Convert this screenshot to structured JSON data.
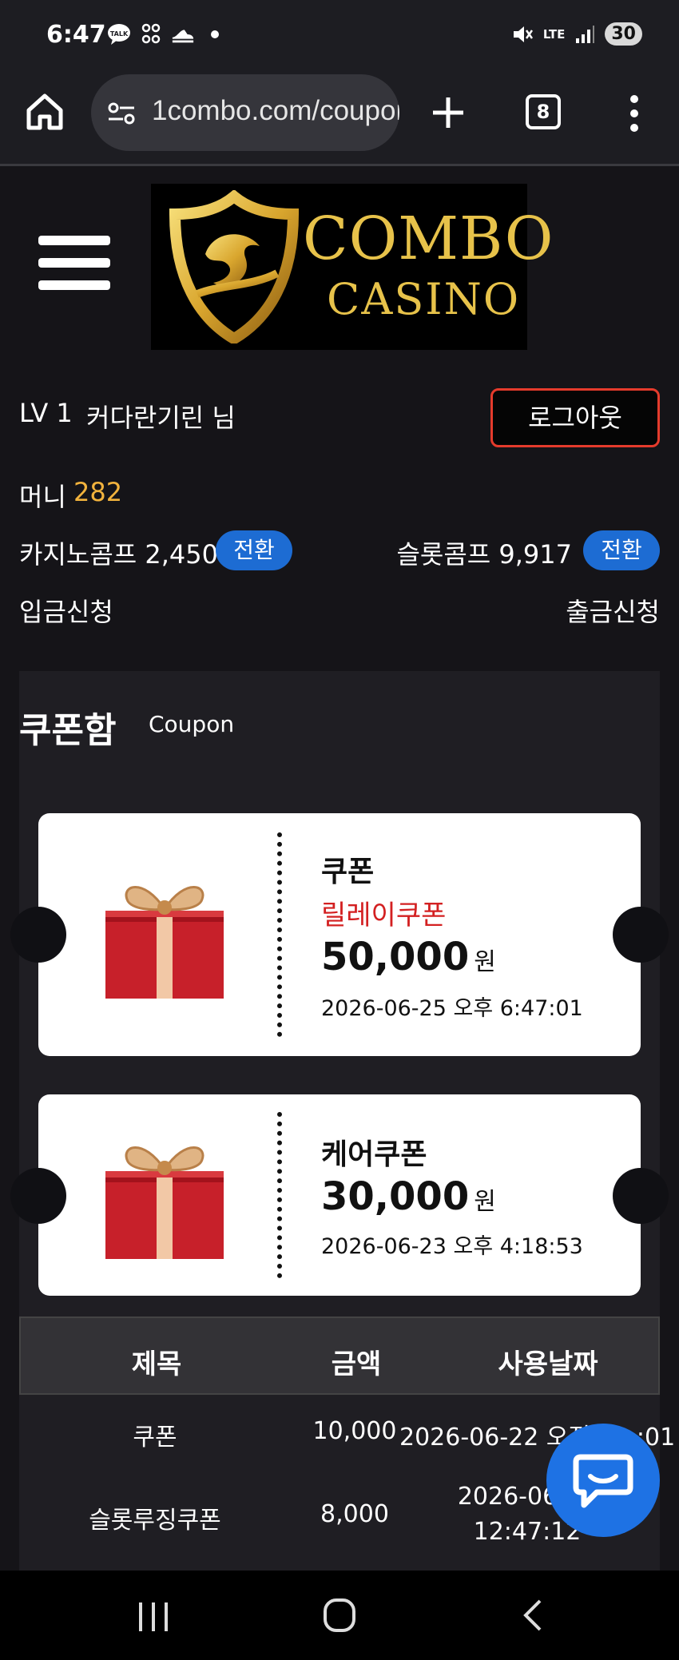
{
  "status_bar": {
    "time": "6:47",
    "network": "LTE",
    "battery": "30"
  },
  "browser": {
    "url": "1combo.com/coupon",
    "tab_count": "8"
  },
  "brand": {
    "logo_line1": "COMBO",
    "logo_line2": "CASINO",
    "gold": "#e7c24a"
  },
  "user": {
    "level": "LV 1",
    "name": "커다란기린 님",
    "logout_label": "로그아웃",
    "money_label": "머니",
    "money_value": "282",
    "casino_comp": "카지노콤프 2,450",
    "slot_comp": "슬롯콤프 9,917",
    "convert_label": "전환",
    "deposit_label": "입금신청",
    "withdraw_label": "출금신청"
  },
  "coupon_section": {
    "title": "쿠폰함",
    "subtitle": "Coupon",
    "coupons": [
      {
        "title": "쿠폰",
        "subtitle": "릴레이쿠폰",
        "amount": "50,000",
        "unit": "원",
        "date": "2026-06-25 오후 6:47:01"
      },
      {
        "title": "케어쿠폰",
        "amount": "30,000",
        "unit": "원",
        "date": "2026-06-23 오후 4:18:53"
      }
    ]
  },
  "history_table": {
    "headers": [
      "제목",
      "금액",
      "사용날짜"
    ],
    "rows": [
      [
        "쿠폰",
        "10,000",
        "2026-06-22 오전 ..:..:01"
      ],
      [
        "슬롯루징쿠폰",
        "8,000",
        "2026-06-2..",
        "12:47:12"
      ]
    ]
  },
  "colors": {
    "accent_blue": "#1d6cd3",
    "logout_border": "#e53b2c",
    "money": "#f2b33d",
    "coupon_red": "#d32021"
  }
}
